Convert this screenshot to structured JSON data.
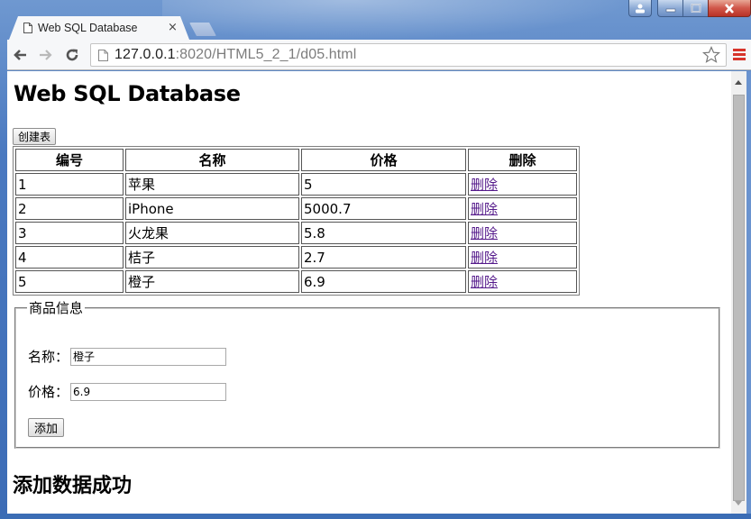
{
  "browser": {
    "tab_title": "Web SQL Database",
    "tab_close": "×",
    "url_host": "127.0.0.1",
    "url_rest": ":8020/HTML5_2_1/d05.html",
    "icons": {
      "back": "arrow-left-icon",
      "forward": "arrow-right-icon",
      "reload": "reload-icon",
      "bookmark": "star-icon",
      "menu": "hamburger-menu-icon",
      "page": "page-icon",
      "user": "user-icon",
      "minimize": "minimize-icon",
      "maximize": "maximize-icon",
      "close": "close-icon"
    },
    "menu_color": "#d7342b"
  },
  "page": {
    "title": "Web SQL Database",
    "create_table_button": "创建表",
    "table": {
      "headers": [
        "编号",
        "名称",
        "价格",
        "删除"
      ],
      "rows": [
        {
          "id": "1",
          "name": "苹果",
          "price": "5",
          "action": "删除"
        },
        {
          "id": "2",
          "name": "iPhone",
          "price": "5000.7",
          "action": "删除"
        },
        {
          "id": "3",
          "name": "火龙果",
          "price": "5.8",
          "action": "删除"
        },
        {
          "id": "4",
          "name": "桔子",
          "price": "2.7",
          "action": "删除"
        },
        {
          "id": "5",
          "name": "橙子",
          "price": "6.9",
          "action": "删除"
        }
      ]
    },
    "form": {
      "legend": "商品信息",
      "name_label": "名称：",
      "name_value": "橙子",
      "price_label": "价格：",
      "price_value": "6.9",
      "add_button": "添加"
    },
    "status_message": "添加数据成功",
    "link_color": "#551a8b"
  }
}
